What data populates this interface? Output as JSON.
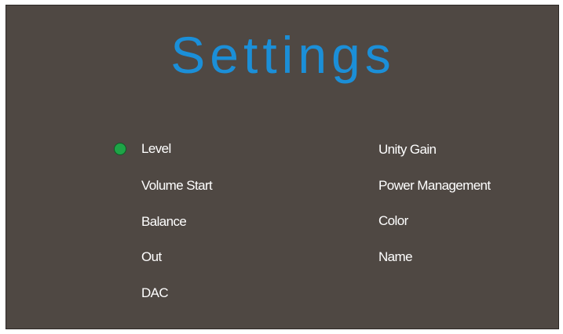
{
  "screen": {
    "title": "Settings",
    "colors": {
      "background": "#4f4843",
      "title": "#1b8fd8",
      "text": "#ffffff",
      "selection_indicator": "#1ea447"
    }
  },
  "menu": {
    "selected_index": 0,
    "selection_icon": "green-dot",
    "left_column": [
      {
        "label": "Level"
      },
      {
        "label": "Volume Start"
      },
      {
        "label": "Balance"
      },
      {
        "label": "Out"
      },
      {
        "label": "DAC"
      }
    ],
    "right_column": [
      {
        "label": "Unity Gain"
      },
      {
        "label": "Power Management"
      },
      {
        "label": "Color"
      },
      {
        "label": "Name"
      }
    ]
  }
}
